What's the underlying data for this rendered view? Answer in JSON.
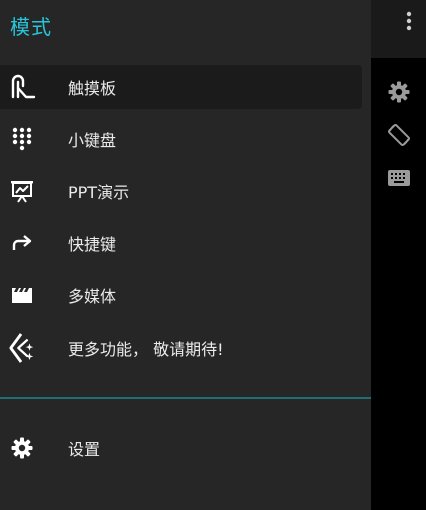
{
  "drawer": {
    "title": "模式",
    "items": [
      {
        "label": "触摸板",
        "icon": "touchpad-icon",
        "active": true
      },
      {
        "label": "小键盘",
        "icon": "numpad-icon"
      },
      {
        "label": "PPT演示",
        "icon": "presentation-icon"
      },
      {
        "label": "快捷键",
        "icon": "shortcut-arrow-icon"
      },
      {
        "label": "多媒体",
        "icon": "media-clapper-icon"
      },
      {
        "label": "更多功能， 敬请期待!",
        "icon": "more-sparkle-icon"
      }
    ],
    "settings": {
      "label": "设置",
      "icon": "gear-icon"
    }
  },
  "toolbar": {
    "icons": [
      "gear-icon",
      "screen-rotation-icon",
      "keyboard-icon",
      "overflow-menu-icon"
    ]
  },
  "colors": {
    "accent": "#26c6da",
    "drawer_bg": "#262626",
    "divider": "#1f6e72"
  }
}
